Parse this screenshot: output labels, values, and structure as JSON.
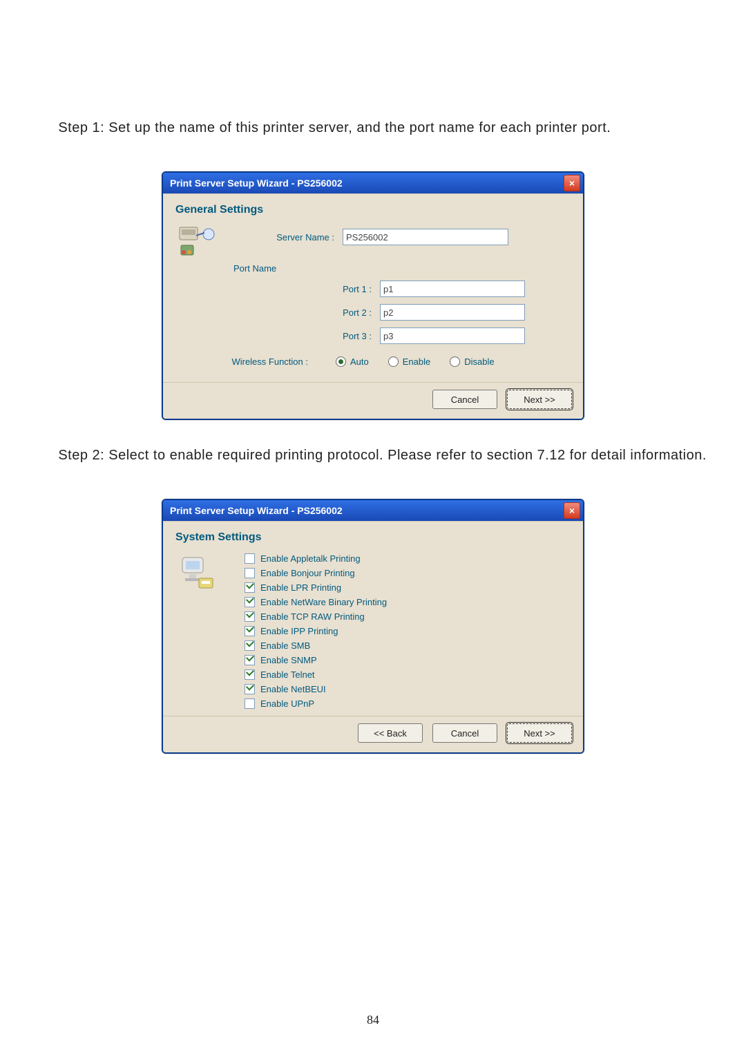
{
  "step1_text": "      Step 1: Set up the name of this printer server, and the port name for each printer port.",
  "step2_text": "      Step 2: Select to enable required printing protocol. Please refer to section 7.12 for detail information.",
  "page_number": "84",
  "dialog1": {
    "title": "Print Server Setup Wizard - PS256002",
    "section_title": "General Settings",
    "server_name_label": "Server Name :",
    "server_name_value": "PS256002",
    "port_name_label": "Port Name",
    "ports": [
      {
        "label": "Port 1 :",
        "value": "p1"
      },
      {
        "label": "Port 2 :",
        "value": "p2"
      },
      {
        "label": "Port 3 :",
        "value": "p3"
      }
    ],
    "wireless_label": "Wireless Function :",
    "wireless_options": {
      "auto": "Auto",
      "enable": "Enable",
      "disable": "Disable"
    },
    "wireless_selected": "auto",
    "buttons": {
      "cancel": "Cancel",
      "next": "Next >>"
    }
  },
  "dialog2": {
    "title": "Print Server Setup Wizard - PS256002",
    "section_title": "System Settings",
    "checks": [
      {
        "label": "Enable Appletalk Printing",
        "checked": false
      },
      {
        "label": "Enable Bonjour Printing",
        "checked": false
      },
      {
        "label": "Enable LPR Printing",
        "checked": true
      },
      {
        "label": "Enable NetWare Binary Printing",
        "checked": true
      },
      {
        "label": "Enable TCP RAW Printing",
        "checked": true
      },
      {
        "label": "Enable IPP Printing",
        "checked": true
      },
      {
        "label": "Enable SMB",
        "checked": true
      },
      {
        "label": "Enable SNMP",
        "checked": true
      },
      {
        "label": "Enable Telnet",
        "checked": true
      },
      {
        "label": "Enable NetBEUI",
        "checked": true
      },
      {
        "label": "Enable UPnP",
        "checked": false
      }
    ],
    "buttons": {
      "back": "<< Back",
      "cancel": "Cancel",
      "next": "Next >>"
    }
  }
}
